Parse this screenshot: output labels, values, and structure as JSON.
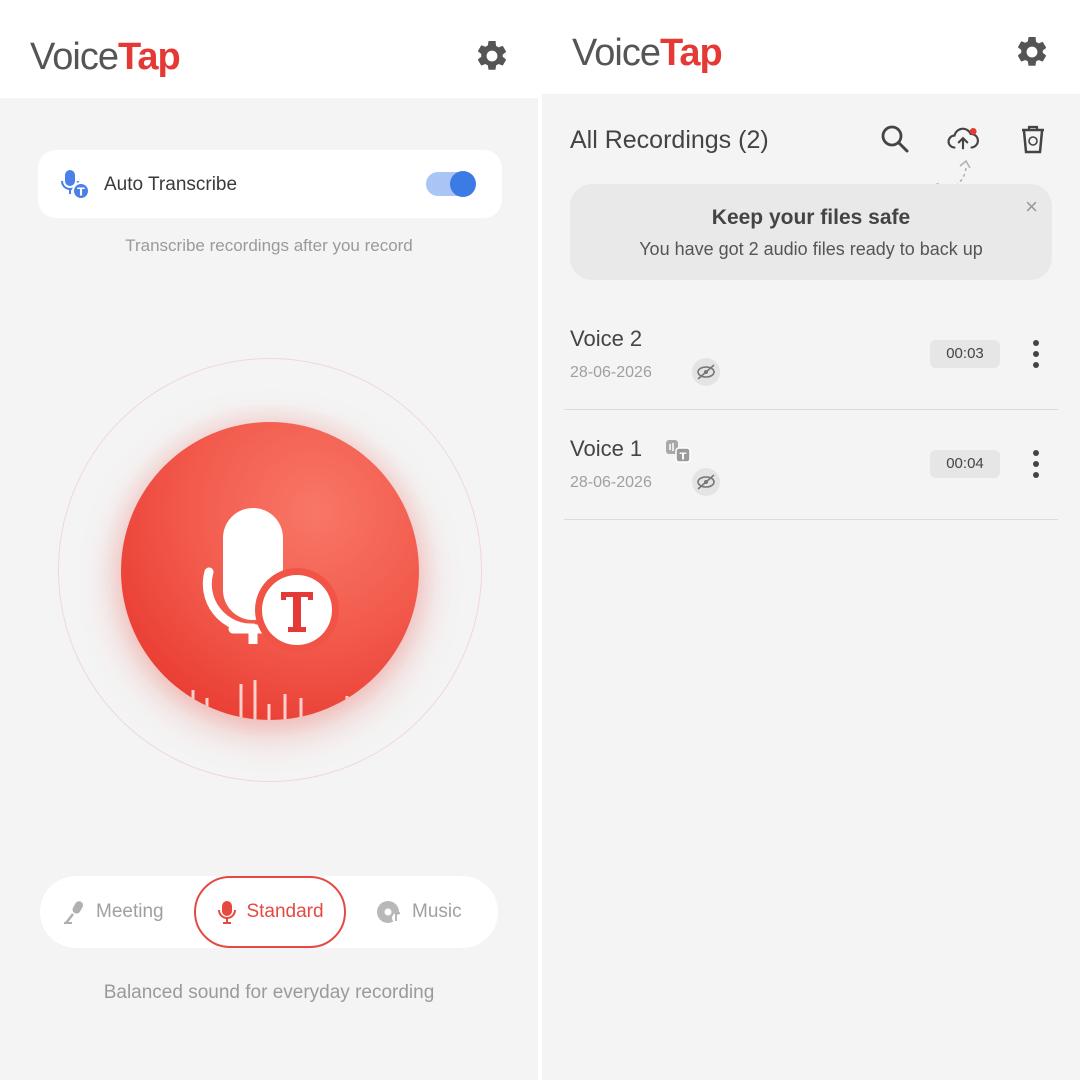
{
  "left_screen": {
    "logo": {
      "voice": "Voice",
      "tap": "Tap"
    },
    "auto_transcribe": {
      "label": "Auto Transcribe",
      "enabled": true,
      "hint": "Transcribe recordings after you record"
    },
    "modes": [
      {
        "label": "Meeting",
        "icon": "microphone-stand-icon",
        "selected": false
      },
      {
        "label": "Standard",
        "icon": "voice-wave-mic-icon",
        "selected": true
      },
      {
        "label": "Music",
        "icon": "music-disc-icon",
        "selected": false
      }
    ],
    "mode_hint": "Balanced sound for everyday recording",
    "colors": {
      "accent": "#e53935",
      "toggle": "#3b7be3"
    }
  },
  "right_screen": {
    "logo": {
      "voice": "Voice",
      "tap": "Tap"
    },
    "list_title": "All Recordings (2)",
    "banner": {
      "title": "Keep your files safe",
      "subtitle": "You have got 2 audio files ready to back up",
      "close": "×"
    },
    "recordings": [
      {
        "name": "Voice 2",
        "date": "28-06-2026",
        "duration": "00:03",
        "transcribed": false
      },
      {
        "name": "Voice 1",
        "date": "28-06-2026",
        "duration": "00:04",
        "transcribed": true
      }
    ]
  }
}
